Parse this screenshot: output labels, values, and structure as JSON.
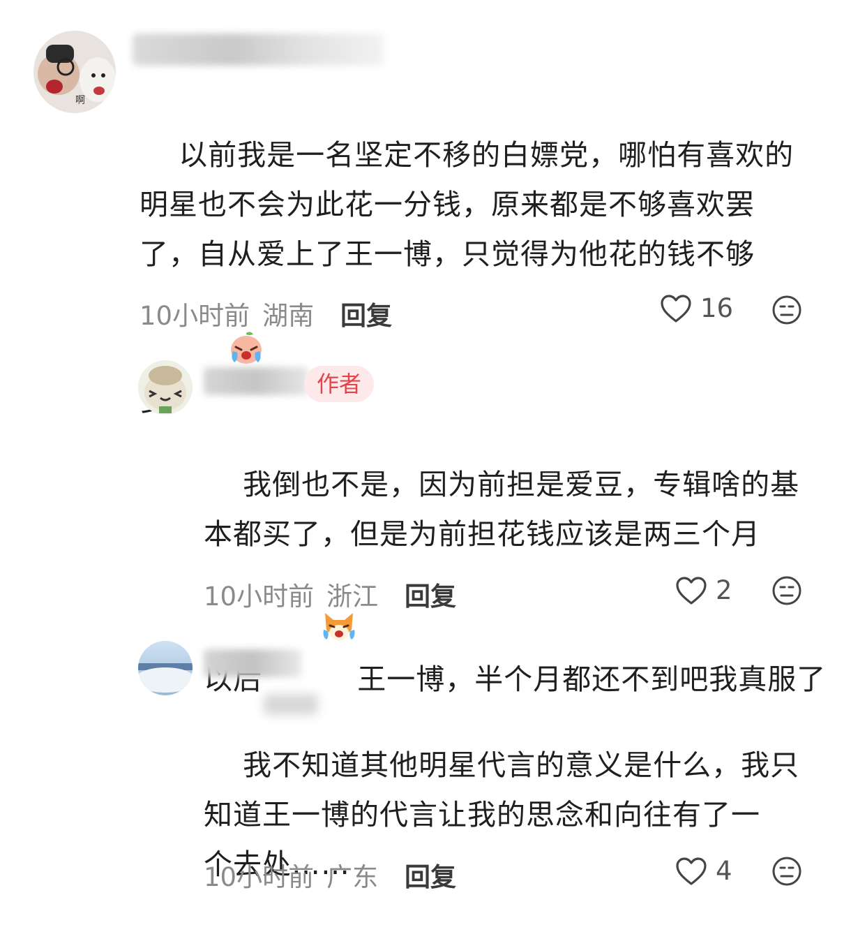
{
  "comments": [
    {
      "text": "以前我是一名坚定不移的白嫖党，哪怕有喜欢的\n明星也不会为此花一分钱，原来都是不够喜欢罢\n了，自从爱上了王一博，只觉得为他花的钱不够\n多",
      "emoji": "crying-peach-emoji",
      "time": "10小时前",
      "location": "湖南",
      "reply_label": "回复",
      "likes": "16"
    },
    {
      "badge": "作者",
      "text_before_emoji": "我倒也不是，因为前担是爱豆，专辑啥的基\n本都买了，但是为前担花钱应该是两三个月\n以后",
      "emoji": "laughing-fox-emoji",
      "text_after_emoji": "王一博，半个月都还不到吧我真服了",
      "time": "10小时前",
      "location": "浙江",
      "reply_label": "回复",
      "likes": "2"
    },
    {
      "text": "我不知道其他明星代言的意义是什么，我只\n知道王一博的代言让我的思念和向往有了一\n个去处……",
      "time": "10小时前",
      "location": "广东",
      "reply_label": "回复",
      "likes": "4"
    }
  ],
  "icons": {
    "like": "heart-outline-icon",
    "dislike": "neutral-face-icon"
  },
  "colors": {
    "badge_bg": "#fde9ea",
    "badge_text": "#e0454d",
    "meta_text": "#8a8a8a"
  }
}
